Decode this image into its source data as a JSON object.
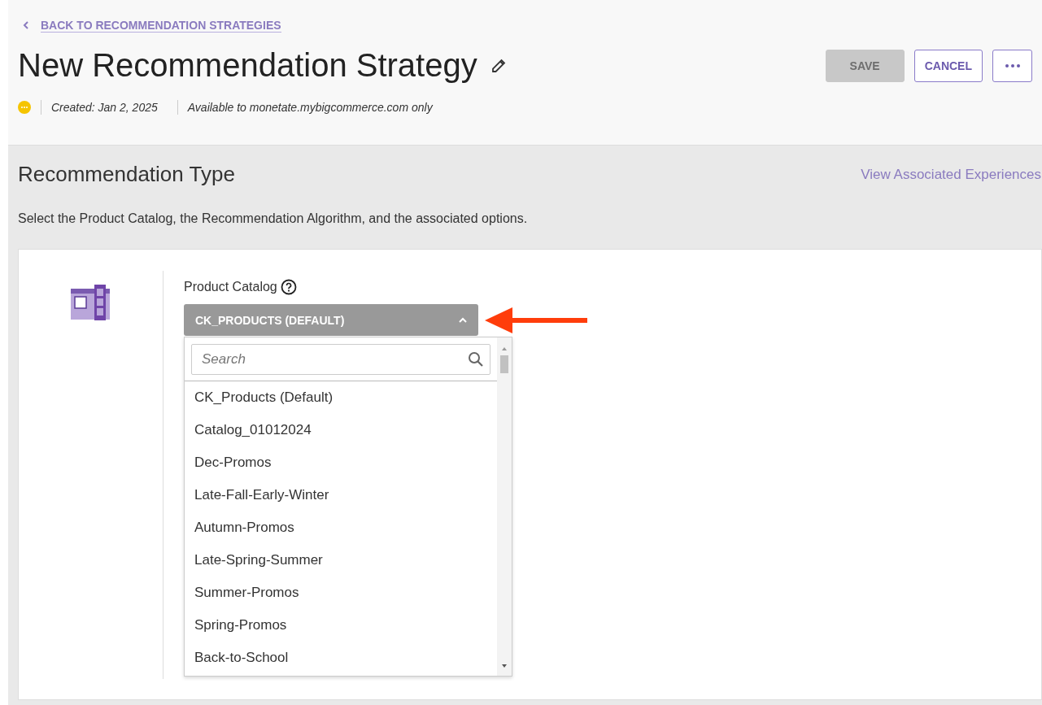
{
  "back_link": {
    "label": "BACK TO RECOMMENDATION STRATEGIES"
  },
  "title": "New Recommendation Strategy",
  "status": {
    "color": "#f5c400"
  },
  "meta": [
    "Created: Jan 2, 2025",
    "Available to monetate.mybigcommerce.com only"
  ],
  "buttons": [
    {
      "label": "SAVE",
      "disabled": true
    },
    {
      "label": "CANCEL",
      "disabled": false
    }
  ],
  "section": {
    "title": "Recommendation Type",
    "link": "View Associated Experiences",
    "description": "Select the Product Catalog, the Recommendation Algorithm, and the associated options."
  },
  "catalog": {
    "label": "Product Catalog",
    "value": "CK_PRODUCTS (DEFAULT)",
    "expanded": true,
    "search": {
      "placeholder": "Search"
    },
    "options": [
      "CK_Products (Default)",
      "Catalog_01012024",
      "Dec-Promos",
      "Late-Fall-Early-Winter",
      "Autumn-Promos",
      "Late-Spring-Summer",
      "Summer-Promos",
      "Spring-Promos",
      "Back-to-School"
    ]
  }
}
